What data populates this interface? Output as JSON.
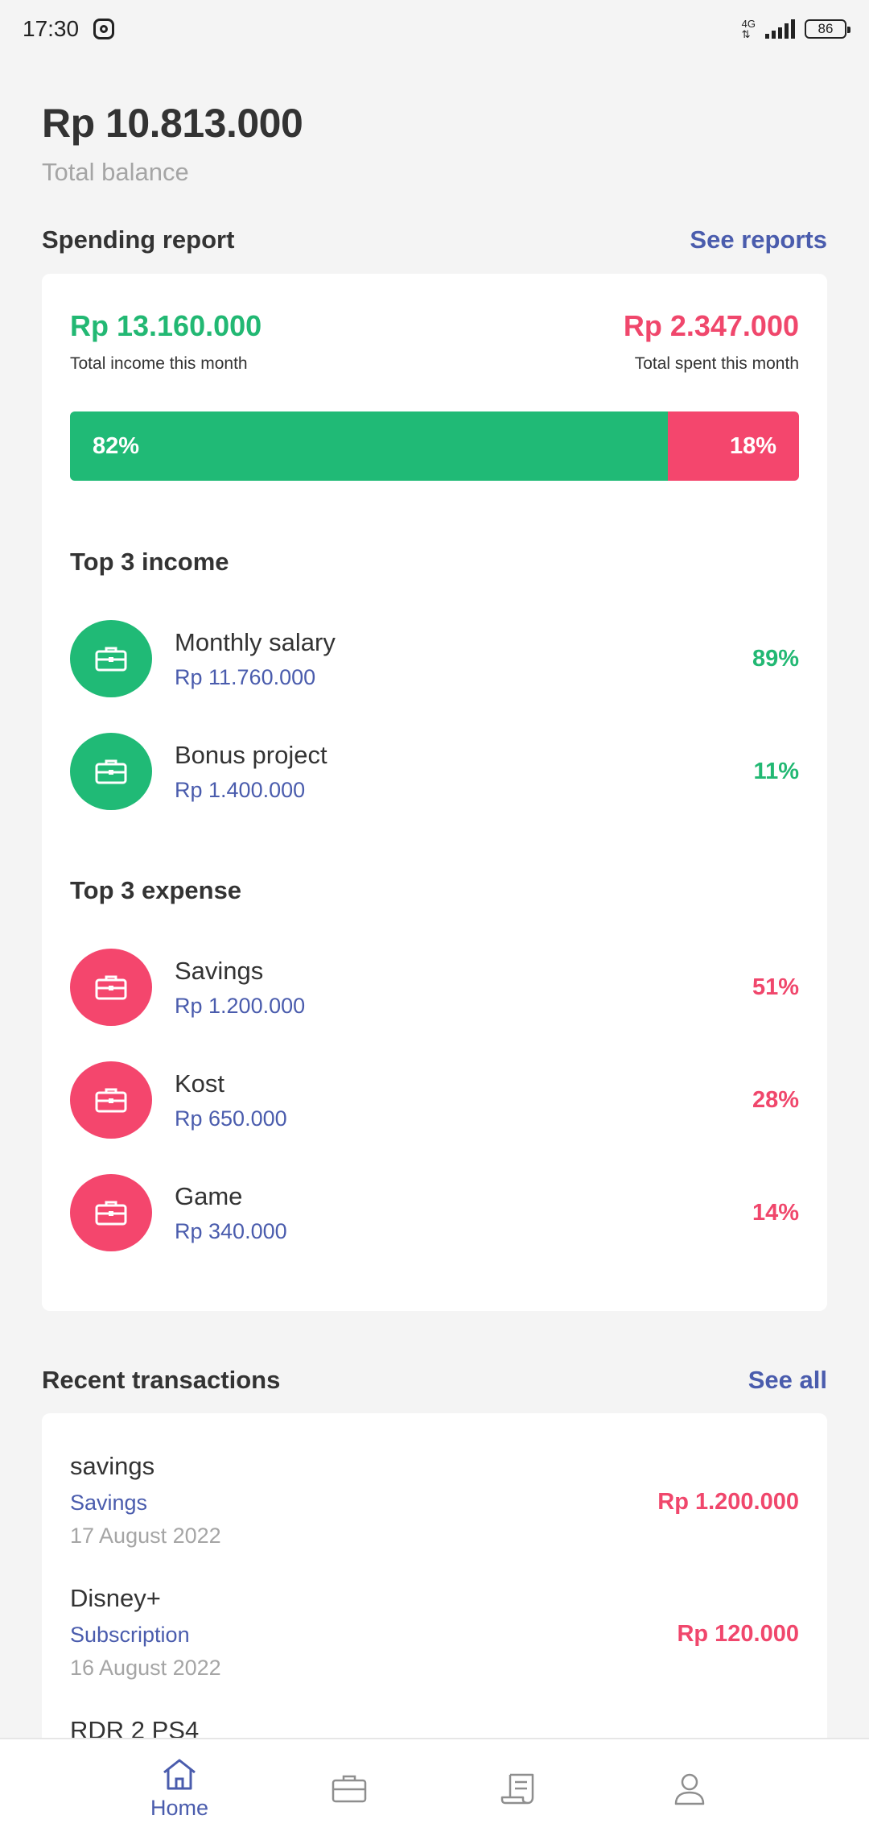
{
  "status_bar": {
    "time": "17:30",
    "network": "4G",
    "battery": "86"
  },
  "balance": {
    "amount": "Rp 10.813.000",
    "label": "Total balance"
  },
  "spending_report": {
    "title": "Spending report",
    "link": "See reports",
    "income_total": "Rp 13.160.000",
    "income_label": "Total income this month",
    "spent_total": "Rp 2.347.000",
    "spent_label": "Total spent this month",
    "income_pct_label": "82%",
    "expense_pct_label": "18%",
    "income_fraction": 0.82,
    "top_income_title": "Top 3 income",
    "top_income": [
      {
        "name": "Monthly salary",
        "amount": "Rp 11.760.000",
        "pct": "89%",
        "icon": "briefcase-icon"
      },
      {
        "name": "Bonus project",
        "amount": "Rp 1.400.000",
        "pct": "11%",
        "icon": "briefcase-icon"
      }
    ],
    "top_expense_title": "Top 3 expense",
    "top_expense": [
      {
        "name": "Savings",
        "amount": "Rp 1.200.000",
        "pct": "51%",
        "icon": "briefcase-icon"
      },
      {
        "name": "Kost",
        "amount": "Rp 650.000",
        "pct": "28%",
        "icon": "briefcase-icon"
      },
      {
        "name": "Game",
        "amount": "Rp 340.000",
        "pct": "14%",
        "icon": "briefcase-icon"
      }
    ]
  },
  "recent": {
    "title": "Recent transactions",
    "link": "See all",
    "items": [
      {
        "name": "savings",
        "category": "Savings",
        "date": "17 August 2022",
        "amount": "Rp 1.200.000"
      },
      {
        "name": "Disney+",
        "category": "Subscription",
        "date": "16 August 2022",
        "amount": "Rp 120.000"
      },
      {
        "name": "RDR 2 PS4"
      }
    ]
  },
  "nav": {
    "home_label": "Home"
  },
  "colors": {
    "income": "#20ba76",
    "expense": "#f4466d",
    "accent": "#4a5cad"
  }
}
